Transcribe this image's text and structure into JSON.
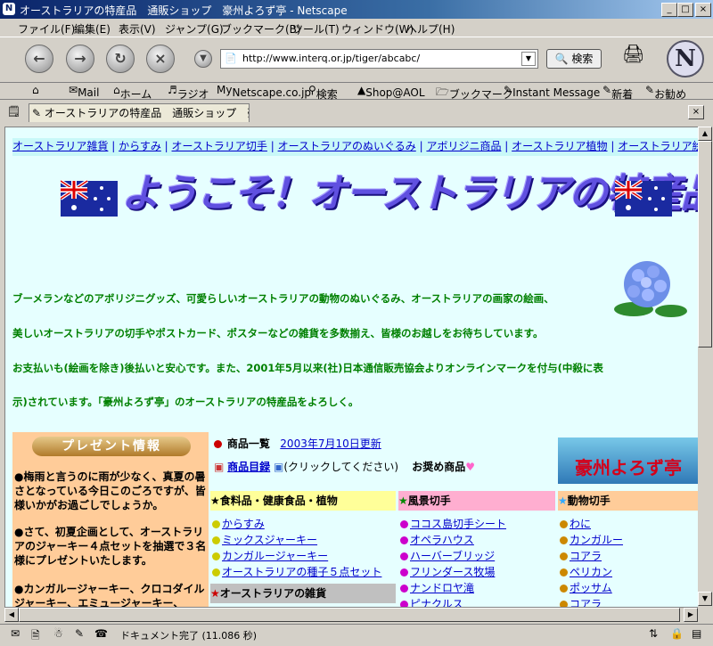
{
  "window": {
    "title": "オーストラリアの特産品　通販ショップ　豪州よろず亭 - Netscape"
  },
  "menu": [
    "ファイル(F)",
    "編集(E)",
    "表示(V)",
    "ジャンプ(G)",
    "ブックマーク(B)",
    "ツール(T)",
    "ウィンドウ(W)",
    "ヘルプ(H)"
  ],
  "nav": {
    "url": "http://www.interq.or.jp/tiger/abcabc/",
    "search_label": "検索",
    "logo": "N"
  },
  "personal_bar": [
    "Mail",
    "ホーム",
    "ラジオ",
    "Netscape.co.jp",
    "検索",
    "Shop@AOL",
    "ブックマーク",
    "Instant Message",
    "新着",
    "お勧め"
  ],
  "tab": {
    "label": "オーストラリアの特産品　通販ショップ　豪州よ..."
  },
  "page": {
    "topnav": [
      "オーストラリア雑貨",
      "からすみ",
      "オーストラリア切手",
      "オーストラリアのぬいぐるみ",
      "アボリジニ商品",
      "オーストラリア植物",
      "オーストラリア絵画"
    ],
    "banner": "ようこそ！オーストラリアの特産品へ",
    "paragraphs": [
      "ブーメランなどのアボリジニグッズ、可愛らしいオーストラリアの動物のぬいぐるみ、オーストラリアの画家の絵画、",
      "美しいオーストラリアの切手やポストカード、ポスターなどの雑貨を多数揃え、皆様のお越しをお待ちしています。",
      "お支払いも(絵画を除き)後払いと安心です。また、2001年5月以来(社)日本通信販売協会よりオンラインマークを付与(中殺に表",
      "示)されています。「豪州よろず亭」のオーストラリアの特産品をよろしく。"
    ],
    "present": {
      "title": "プレゼント情報",
      "lines": [
        "●梅雨と言うのに雨が少なく、真夏の暑さとなっている今日このごろですが、皆様いかがお過ごしでしょうか。",
        "●さて、初夏企画として、オーストラリアのジャーキー４点セットを抽選で３名様にプレゼントいたします。",
        "●カンガルージャーキー、クロコダイルジャーキー、エミュージャーキー、"
      ]
    },
    "catalog": {
      "heading": "商品一覧",
      "updated": "2003年7月10日更新",
      "list_link": "商品目録",
      "click_hint": "(クリックしてください)",
      "recommend": "お奨め商品"
    },
    "shop_logo": "豪州よろず亭",
    "sections": [
      {
        "title": "食料品・健康食品・植物",
        "items": [
          "からすみ",
          "ミックスジャーキー",
          "カンガルージャーキー",
          "オーストラリアの種子５点セット"
        ]
      },
      {
        "title": "風景切手",
        "items": [
          "ココス島切手シート",
          "オペラハウス",
          "ハーバーブリッジ",
          "フリンダース牧場",
          "ナンドロヤ滝",
          "ピナクルス"
        ]
      },
      {
        "title": "動物切手",
        "items": [
          "わに",
          "カンガルー",
          "コアラ",
          "ペリカン",
          "ポッサム",
          "コアラ"
        ]
      },
      {
        "title": "オーストラリアの雑貨",
        "items": []
      }
    ]
  },
  "status": {
    "text": "ドキュメント完了 (11.086 秒)"
  }
}
